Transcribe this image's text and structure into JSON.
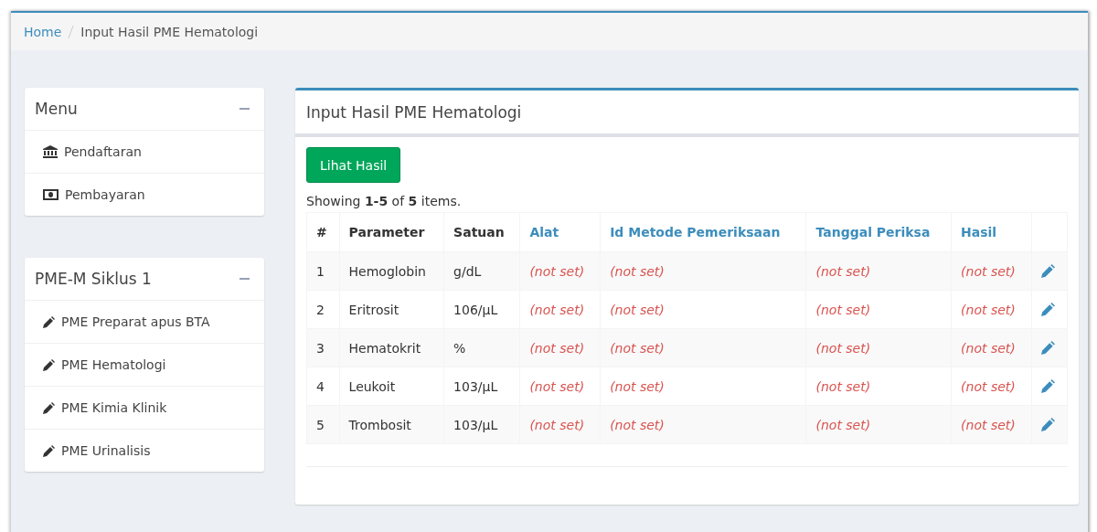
{
  "breadcrumb": [
    {
      "label": "Home",
      "kind": "link"
    },
    {
      "label": "Input Hasil PME Hematologi",
      "kind": "current"
    }
  ],
  "sidebar": [
    {
      "title": "Menu",
      "items": [
        {
          "label": "Pendaftaran",
          "kind": "bank"
        },
        {
          "label": "Pembayaran",
          "kind": "money"
        }
      ]
    },
    {
      "title": "PME-M Siklus 1",
      "items": [
        {
          "label": "PME Preparat apus BTA",
          "kind": "pencil"
        },
        {
          "label": "PME Hematologi",
          "kind": "pencil"
        },
        {
          "label": "PME Kimia Klinik",
          "kind": "pencil"
        },
        {
          "label": "PME Urinalisis",
          "kind": "pencil"
        }
      ]
    }
  ],
  "main": {
    "title": "Input Hasil PME Hematologi",
    "button": "Lihat Hasil",
    "summary": "Showing **1-5** of **5** items.",
    "columns": [
      {
        "label": "#",
        "kind": "plain"
      },
      {
        "label": "Parameter",
        "kind": "plain"
      },
      {
        "label": "Satuan",
        "kind": "plain"
      },
      {
        "label": "Alat",
        "kind": "link"
      },
      {
        "label": "Id Metode Pemeriksaan",
        "kind": "link"
      },
      {
        "label": "Tanggal Periksa",
        "kind": "link"
      },
      {
        "label": "Hasil",
        "kind": "link"
      }
    ],
    "rows": [
      {
        "cells": [
          {
            "text": "1",
            "kind": "plain"
          },
          {
            "text": "Hemoglobin",
            "kind": "plain"
          },
          {
            "text": "g/dL",
            "kind": "plain"
          },
          {
            "text": "(not set)",
            "kind": "null"
          },
          {
            "text": "(not set)",
            "kind": "null"
          },
          {
            "text": "(not set)",
            "kind": "null"
          },
          {
            "text": "(not set)",
            "kind": "null"
          }
        ]
      },
      {
        "cells": [
          {
            "text": "2",
            "kind": "plain"
          },
          {
            "text": "Eritrosit",
            "kind": "plain"
          },
          {
            "text": "106/µL",
            "kind": "plain"
          },
          {
            "text": "(not set)",
            "kind": "null"
          },
          {
            "text": "(not set)",
            "kind": "null"
          },
          {
            "text": "(not set)",
            "kind": "null"
          },
          {
            "text": "(not set)",
            "kind": "null"
          }
        ]
      },
      {
        "cells": [
          {
            "text": "3",
            "kind": "plain"
          },
          {
            "text": "Hematokrit",
            "kind": "plain"
          },
          {
            "text": "%",
            "kind": "plain"
          },
          {
            "text": "(not set)",
            "kind": "null"
          },
          {
            "text": "(not set)",
            "kind": "null"
          },
          {
            "text": "(not set)",
            "kind": "null"
          },
          {
            "text": "(not set)",
            "kind": "null"
          }
        ]
      },
      {
        "cells": [
          {
            "text": "4",
            "kind": "plain"
          },
          {
            "text": "Leukoit",
            "kind": "plain"
          },
          {
            "text": "103/µL",
            "kind": "plain"
          },
          {
            "text": "(not set)",
            "kind": "null"
          },
          {
            "text": "(not set)",
            "kind": "null"
          },
          {
            "text": "(not set)",
            "kind": "null"
          },
          {
            "text": "(not set)",
            "kind": "null"
          }
        ]
      },
      {
        "cells": [
          {
            "text": "5",
            "kind": "plain"
          },
          {
            "text": "Trombosit",
            "kind": "plain"
          },
          {
            "text": "103/µL",
            "kind": "plain"
          },
          {
            "text": "(not set)",
            "kind": "null"
          },
          {
            "text": "(not set)",
            "kind": "null"
          },
          {
            "text": "(not set)",
            "kind": "null"
          },
          {
            "text": "(not set)",
            "kind": "null"
          }
        ]
      }
    ]
  }
}
